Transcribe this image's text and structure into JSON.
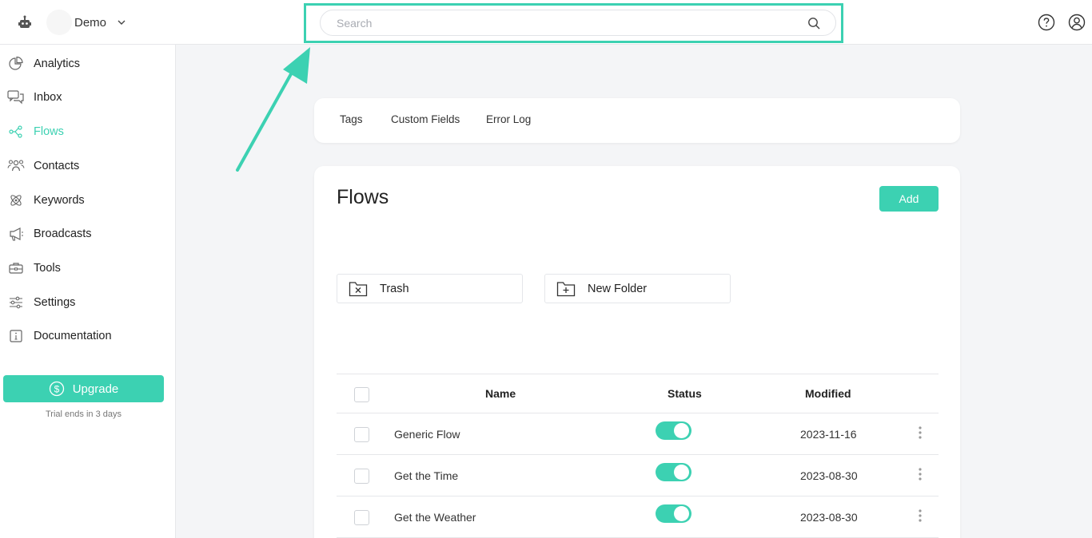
{
  "header": {
    "workspace_name": "Demo",
    "search_placeholder": "Search"
  },
  "sidebar": {
    "items": [
      {
        "label": "Analytics",
        "icon": "pie-chart-icon",
        "active": false
      },
      {
        "label": "Inbox",
        "icon": "chat-bubbles-icon",
        "active": false
      },
      {
        "label": "Flows",
        "icon": "share-nodes-icon",
        "active": true
      },
      {
        "label": "Contacts",
        "icon": "people-icon",
        "active": false
      },
      {
        "label": "Keywords",
        "icon": "atom-icon",
        "active": false
      },
      {
        "label": "Broadcasts",
        "icon": "megaphone-icon",
        "active": false
      },
      {
        "label": "Tools",
        "icon": "toolbox-icon",
        "active": false
      },
      {
        "label": "Settings",
        "icon": "sliders-icon",
        "active": false
      },
      {
        "label": "Documentation",
        "icon": "info-icon",
        "active": false
      }
    ],
    "upgrade_label": "Upgrade",
    "trial_text": "Trial ends in 3 days"
  },
  "tabs": [
    "Tags",
    "Custom Fields",
    "Error Log"
  ],
  "flows": {
    "title": "Flows",
    "add_label": "Add",
    "folders": [
      {
        "label": "Trash",
        "icon": "folder-x-icon"
      },
      {
        "label": "New Folder",
        "icon": "folder-plus-icon"
      }
    ],
    "columns": {
      "name": "Name",
      "status": "Status",
      "modified": "Modified"
    },
    "rows": [
      {
        "name": "Generic Flow",
        "status_on": true,
        "modified": "2023-11-16"
      },
      {
        "name": "Get the Time",
        "status_on": true,
        "modified": "2023-08-30"
      },
      {
        "name": "Get the Weather",
        "status_on": true,
        "modified": "2023-08-30"
      }
    ]
  },
  "colors": {
    "accent": "#3cd1b2",
    "active_nav": "#3cd1b2"
  }
}
